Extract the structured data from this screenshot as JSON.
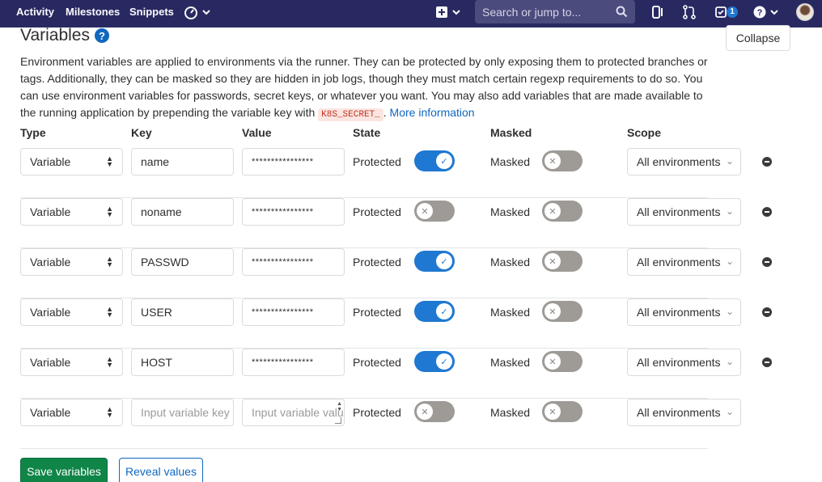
{
  "nav": {
    "activity": "Activity",
    "milestones": "Milestones",
    "snippets": "Snippets",
    "search_placeholder": "Search or jump to...",
    "todo_count": "1",
    "icons": [
      "dashboard-icon",
      "plus-icon",
      "issues-icon",
      "merge-request-icon",
      "todo-icon",
      "help-icon",
      "avatar"
    ]
  },
  "section": {
    "title": "Variables",
    "collapse_label": "Collapse",
    "description_1": "Environment variables are applied to environments via the runner. They can be protected by only exposing them to protected branches or tags. Additionally, they can be masked so they are hidden in job logs, though they must match certain regexp requirements to do so. You can use environment variables for passwords, secret keys, or whatever you want. You may also add variables that are made available to the running application by prepending the variable key with",
    "code": "K8S_SECRET_",
    "description_2": ".",
    "more_info": "More information"
  },
  "columns": {
    "type": "Type",
    "key": "Key",
    "value": "Value",
    "state": "State",
    "masked": "Masked",
    "scope": "Scope"
  },
  "variables": [
    {
      "type": "Variable",
      "key": "name",
      "value": "****************",
      "state_label": "Protected",
      "protected": true,
      "masked_label": "Masked",
      "masked": false,
      "scope": "All environments"
    },
    {
      "type": "Variable",
      "key": "noname",
      "value": "****************",
      "state_label": "Protected",
      "protected": false,
      "masked_label": "Masked",
      "masked": false,
      "scope": "All environments"
    },
    {
      "type": "Variable",
      "key": "PASSWD",
      "value": "****************",
      "state_label": "Protected",
      "protected": true,
      "masked_label": "Masked",
      "masked": false,
      "scope": "All environments"
    },
    {
      "type": "Variable",
      "key": "USER",
      "value": "****************",
      "state_label": "Protected",
      "protected": true,
      "masked_label": "Masked",
      "masked": false,
      "scope": "All environments"
    },
    {
      "type": "Variable",
      "key": "HOST",
      "value": "****************",
      "state_label": "Protected",
      "protected": true,
      "masked_label": "Masked",
      "masked": false,
      "scope": "All environments"
    }
  ],
  "new_row": {
    "type": "Variable",
    "key_placeholder": "Input variable key",
    "value_placeholder": "Input variable value",
    "state_label": "Protected",
    "protected": false,
    "masked_label": "Masked",
    "masked": false,
    "scope": "All environments"
  },
  "actions": {
    "save": "Save variables",
    "reveal": "Reveal values"
  },
  "colors": {
    "nav_bg": "#292961",
    "toggle_on": "#1f78d1",
    "toggle_off": "#9e9a96",
    "save_bg": "#108548",
    "link": "#1068bf"
  }
}
